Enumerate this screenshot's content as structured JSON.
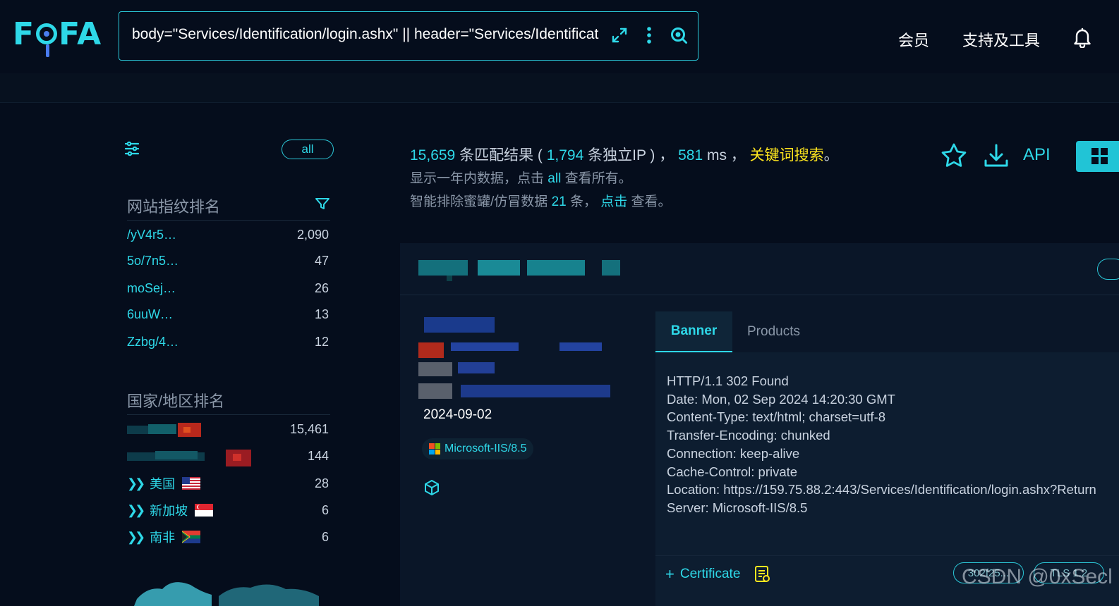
{
  "header": {
    "logo_text": "FOFA",
    "search_value": "body=\"Services/Identification/login.ashx\" || header=\"Services/Identificat",
    "nav": [
      "会员",
      "支持及工具"
    ]
  },
  "sidebar": {
    "all_label": "all",
    "fingerprint_title": "网站指纹排名",
    "fingerprints": [
      {
        "label": "/yV4r5…",
        "count": "2,090"
      },
      {
        "label": "5o/7n5…",
        "count": "47"
      },
      {
        "label": "moSej…",
        "count": "26"
      },
      {
        "label": "6uuW…",
        "count": "13"
      },
      {
        "label": "Zzbg/4…",
        "count": "12"
      }
    ],
    "country_title": "国家/地区排名",
    "countries": [
      {
        "label": "",
        "count": "15,461"
      },
      {
        "label": "",
        "count": "144"
      },
      {
        "label": "美国",
        "count": "28"
      },
      {
        "label": "新加坡",
        "count": "6"
      },
      {
        "label": "南非",
        "count": "6"
      }
    ]
  },
  "stats": {
    "total": "15,659",
    "total_suffix": " 条匹配结果 ( ",
    "ip": "1,794",
    "ip_suffix": " 条独立IP ) ， ",
    "ms": "581",
    "ms_suffix": " ms ， ",
    "keyword": "关键词搜索",
    "end": "。",
    "line2_a": "显示一年内数据，点击 ",
    "line2_all": "all",
    "line2_b": " 查看所有。",
    "line3_a": "智能排除蜜罐/仿冒数据 ",
    "line3_num": "21",
    "line3_b": " 条， ",
    "line3_click": "点击",
    "line3_c": " 查看。",
    "api_label": "API"
  },
  "result": {
    "date": "2024-09-02",
    "server": "Microsoft-IIS/8.5",
    "tabs": [
      "Banner",
      "Products"
    ],
    "banner": "HTTP/1.1 302 Found\nDate: Mon, 02 Sep 2024 14:20:30 GMT\nContent-Type: text/html; charset=utf-8\nTransfer-Encoding: chunked\nConnection: keep-alive\nCache-Control: private\nLocation: https://159.75.88.2:443/Services/Identification/login.ashx?Return\nServer: Microsoft-IIS/8.5",
    "certificate_label": "Certificate",
    "pills": [
      "302f25...",
      "TLS 1.2"
    ]
  },
  "watermark": "CSDN @0xSecl",
  "colors": {
    "accent": "#2ed8e8",
    "background": "#050d1c",
    "keyword": "#ffe61e"
  }
}
